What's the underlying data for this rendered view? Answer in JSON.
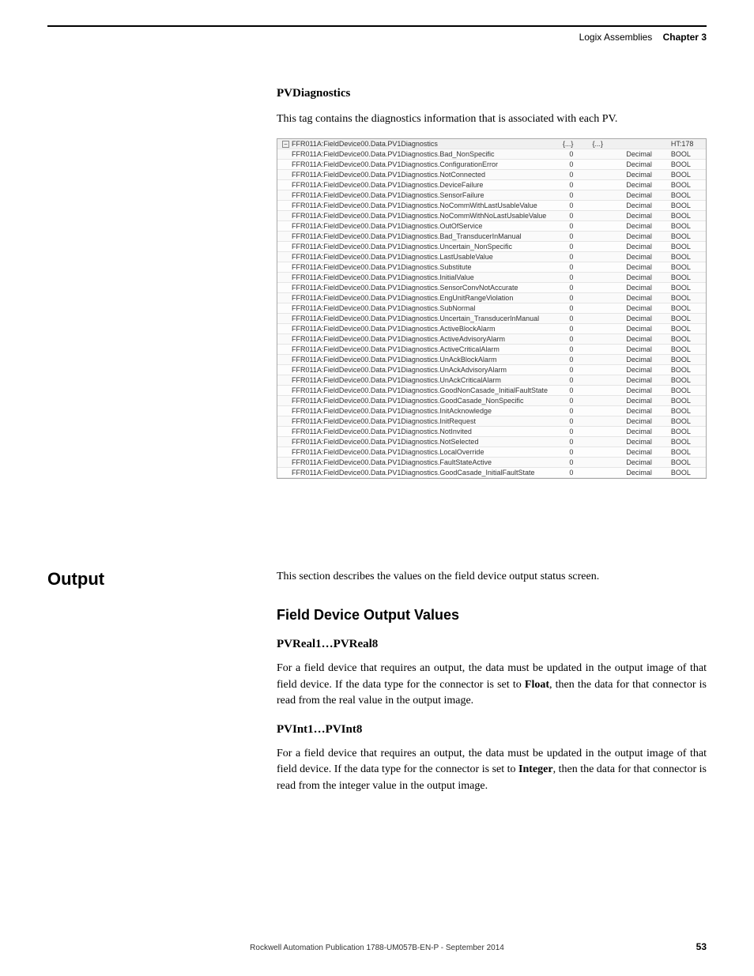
{
  "header": {
    "label": "Logix Assemblies",
    "chapter": "Chapter 3"
  },
  "pvdiag": {
    "title": "PVDiagnostics",
    "intro": "This tag contains the diagnostics information that is associated with each PV.",
    "parent_row": {
      "name": "FFR011A:FieldDevice00.Data.PV1Diagnostics",
      "v1": "{...}",
      "v2": "{...}",
      "style": "",
      "type": "HT:178"
    },
    "rows": [
      {
        "name": "FFR011A:FieldDevice00.Data.PV1Diagnostics.Bad_NonSpecific",
        "v1": "0",
        "style": "Decimal",
        "type": "BOOL"
      },
      {
        "name": "FFR011A:FieldDevice00.Data.PV1Diagnostics.ConfigurationError",
        "v1": "0",
        "style": "Decimal",
        "type": "BOOL"
      },
      {
        "name": "FFR011A:FieldDevice00.Data.PV1Diagnostics.NotConnected",
        "v1": "0",
        "style": "Decimal",
        "type": "BOOL"
      },
      {
        "name": "FFR011A:FieldDevice00.Data.PV1Diagnostics.DeviceFailure",
        "v1": "0",
        "style": "Decimal",
        "type": "BOOL"
      },
      {
        "name": "FFR011A:FieldDevice00.Data.PV1Diagnostics.SensorFailure",
        "v1": "0",
        "style": "Decimal",
        "type": "BOOL"
      },
      {
        "name": "FFR011A:FieldDevice00.Data.PV1Diagnostics.NoCommWithLastUsableValue",
        "v1": "0",
        "style": "Decimal",
        "type": "BOOL"
      },
      {
        "name": "FFR011A:FieldDevice00.Data.PV1Diagnostics.NoCommWithNoLastUsableValue",
        "v1": "0",
        "style": "Decimal",
        "type": "BOOL"
      },
      {
        "name": "FFR011A:FieldDevice00.Data.PV1Diagnostics.OutOfService",
        "v1": "0",
        "style": "Decimal",
        "type": "BOOL"
      },
      {
        "name": "FFR011A:FieldDevice00.Data.PV1Diagnostics.Bad_TransducerInManual",
        "v1": "0",
        "style": "Decimal",
        "type": "BOOL"
      },
      {
        "name": "FFR011A:FieldDevice00.Data.PV1Diagnostics.Uncertain_NonSpecific",
        "v1": "0",
        "style": "Decimal",
        "type": "BOOL"
      },
      {
        "name": "FFR011A:FieldDevice00.Data.PV1Diagnostics.LastUsableValue",
        "v1": "0",
        "style": "Decimal",
        "type": "BOOL"
      },
      {
        "name": "FFR011A:FieldDevice00.Data.PV1Diagnostics.Substitute",
        "v1": "0",
        "style": "Decimal",
        "type": "BOOL"
      },
      {
        "name": "FFR011A:FieldDevice00.Data.PV1Diagnostics.InitialValue",
        "v1": "0",
        "style": "Decimal",
        "type": "BOOL"
      },
      {
        "name": "FFR011A:FieldDevice00.Data.PV1Diagnostics.SensorConvNotAccurate",
        "v1": "0",
        "style": "Decimal",
        "type": "BOOL"
      },
      {
        "name": "FFR011A:FieldDevice00.Data.PV1Diagnostics.EngUnitRangeViolation",
        "v1": "0",
        "style": "Decimal",
        "type": "BOOL"
      },
      {
        "name": "FFR011A:FieldDevice00.Data.PV1Diagnostics.SubNormal",
        "v1": "0",
        "style": "Decimal",
        "type": "BOOL"
      },
      {
        "name": "FFR011A:FieldDevice00.Data.PV1Diagnostics.Uncertain_TransducerInManual",
        "v1": "0",
        "style": "Decimal",
        "type": "BOOL"
      },
      {
        "name": "FFR011A:FieldDevice00.Data.PV1Diagnostics.ActiveBlockAlarm",
        "v1": "0",
        "style": "Decimal",
        "type": "BOOL"
      },
      {
        "name": "FFR011A:FieldDevice00.Data.PV1Diagnostics.ActiveAdvisoryAlarm",
        "v1": "0",
        "style": "Decimal",
        "type": "BOOL"
      },
      {
        "name": "FFR011A:FieldDevice00.Data.PV1Diagnostics.ActiveCriticalAlarm",
        "v1": "0",
        "style": "Decimal",
        "type": "BOOL"
      },
      {
        "name": "FFR011A:FieldDevice00.Data.PV1Diagnostics.UnAckBlockAlarm",
        "v1": "0",
        "style": "Decimal",
        "type": "BOOL"
      },
      {
        "name": "FFR011A:FieldDevice00.Data.PV1Diagnostics.UnAckAdvisoryAlarm",
        "v1": "0",
        "style": "Decimal",
        "type": "BOOL"
      },
      {
        "name": "FFR011A:FieldDevice00.Data.PV1Diagnostics.UnAckCriticalAlarm",
        "v1": "0",
        "style": "Decimal",
        "type": "BOOL"
      },
      {
        "name": "FFR011A:FieldDevice00.Data.PV1Diagnostics.GoodNonCasade_InitialFaultState",
        "v1": "0",
        "style": "Decimal",
        "type": "BOOL"
      },
      {
        "name": "FFR011A:FieldDevice00.Data.PV1Diagnostics.GoodCasade_NonSpecific",
        "v1": "0",
        "style": "Decimal",
        "type": "BOOL"
      },
      {
        "name": "FFR011A:FieldDevice00.Data.PV1Diagnostics.InitAcknowledge",
        "v1": "0",
        "style": "Decimal",
        "type": "BOOL"
      },
      {
        "name": "FFR011A:FieldDevice00.Data.PV1Diagnostics.InitRequest",
        "v1": "0",
        "style": "Decimal",
        "type": "BOOL"
      },
      {
        "name": "FFR011A:FieldDevice00.Data.PV1Diagnostics.NotInvited",
        "v1": "0",
        "style": "Decimal",
        "type": "BOOL"
      },
      {
        "name": "FFR011A:FieldDevice00.Data.PV1Diagnostics.NotSelected",
        "v1": "0",
        "style": "Decimal",
        "type": "BOOL"
      },
      {
        "name": "FFR011A:FieldDevice00.Data.PV1Diagnostics.LocalOverride",
        "v1": "0",
        "style": "Decimal",
        "type": "BOOL"
      },
      {
        "name": "FFR011A:FieldDevice00.Data.PV1Diagnostics.FaultStateActive",
        "v1": "0",
        "style": "Decimal",
        "type": "BOOL"
      },
      {
        "name": "FFR011A:FieldDevice00.Data.PV1Diagnostics.GoodCasade_InitialFaultState",
        "v1": "0",
        "style": "Decimal",
        "type": "BOOL"
      }
    ]
  },
  "output": {
    "section_title": "Output",
    "intro": "This section describes the values on the field device output status screen.",
    "h2": "Field Device Output Values",
    "sub1_title": "PVReal1…PVReal8",
    "sub1_para_a": "For a field device that requires an output, the data must be updated in the output image of that field device. If the data type for the connector is set to ",
    "sub1_bold": "Float",
    "sub1_para_b": ", then the data for that connector is read from the real value in the output image.",
    "sub2_title": "PVInt1…PVInt8",
    "sub2_para_a": "For a field device that requires an output, the data must be updated in the output image of that field device. If the data type for the connector is set to ",
    "sub2_bold": "Integer",
    "sub2_para_b": ", then the data for that connector is read from the integer value in the output image."
  },
  "footer": {
    "pub": "Rockwell Automation Publication 1788-UM057B-EN-P - September 2014",
    "page": "53"
  }
}
